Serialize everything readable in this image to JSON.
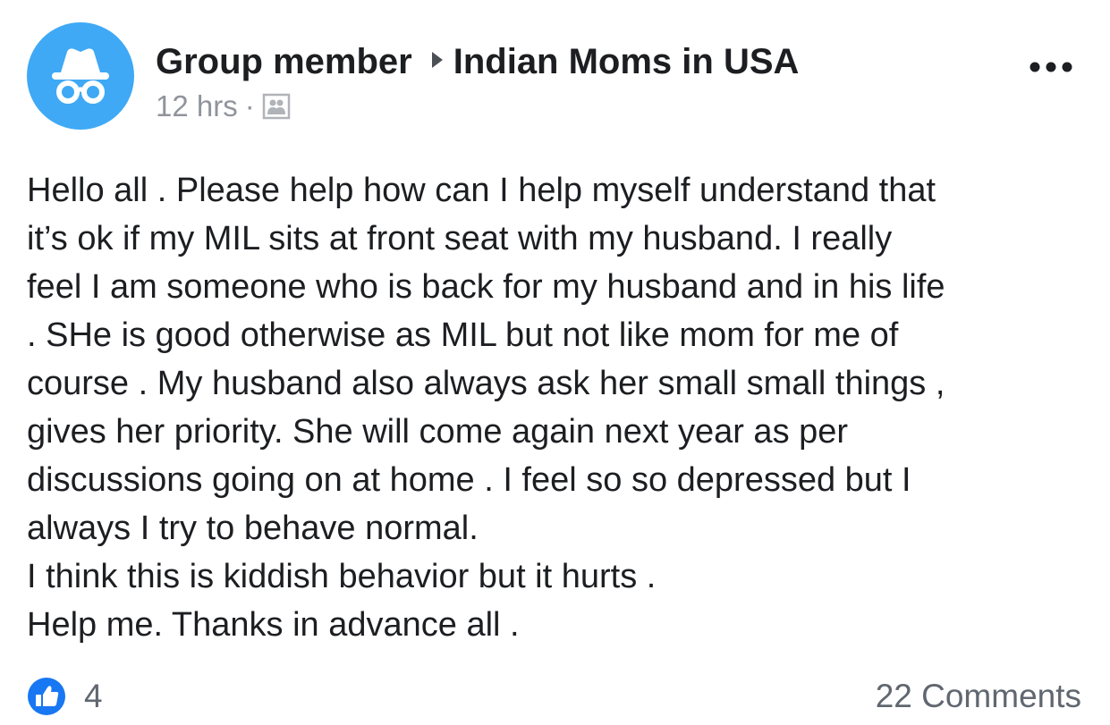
{
  "post": {
    "author": "Group member",
    "group": "Indian Moms in USA",
    "time": "12 hrs",
    "separator": "·",
    "privacy_icon": "group-members-icon",
    "more_icon": "more-options-icon",
    "body_lines": [
      "Hello all . Please help how can I help myself understand that",
      "it’s ok if my MIL sits at front seat with my husband. I really",
      "feel I am someone who is back for my husband and in his life",
      ". SHe is good otherwise as MIL but not like mom for me of",
      "course . My husband also always ask her small small things ,",
      "gives her priority. She will come again next year as per",
      "discussions going on at home . I feel so so depressed but I",
      "always I try to behave normal.",
      "I think this is kiddish behavior but it hurts .",
      "Help me. Thanks in advance all ."
    ]
  },
  "footer": {
    "like_count": "4",
    "comments_label": "22 Comments"
  },
  "colors": {
    "avatar_bg": "#3fa9f5",
    "like_blue": "#1877f2",
    "meta_gray": "#90949c"
  }
}
